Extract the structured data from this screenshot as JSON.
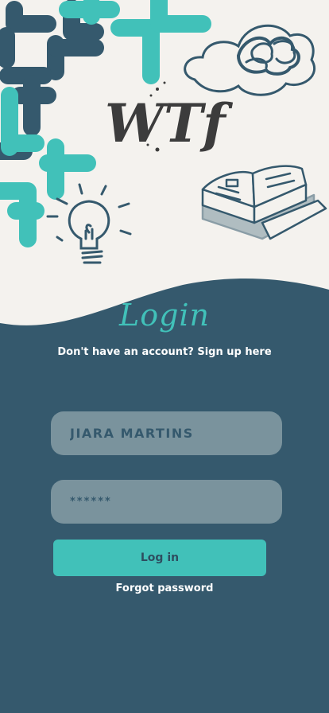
{
  "hero": {
    "logo_text": "WTf",
    "icons": [
      "puzzle-shapes-pattern",
      "cloud-scribble-icon",
      "lightbulb-icon",
      "open-book-icon"
    ]
  },
  "login": {
    "title": "Login",
    "signup_prompt": "Don't have an account? Sign up here",
    "username_value": "JIARA MARTINS",
    "password_value": "******",
    "login_button": "Log in",
    "forgot_password": "Forgot password"
  },
  "colors": {
    "background_light": "#f4f2ee",
    "panel_dark": "#35596d",
    "accent_teal": "#41c1b9",
    "field_gray": "#7a939d",
    "text_dark": "#3c3c3c"
  }
}
